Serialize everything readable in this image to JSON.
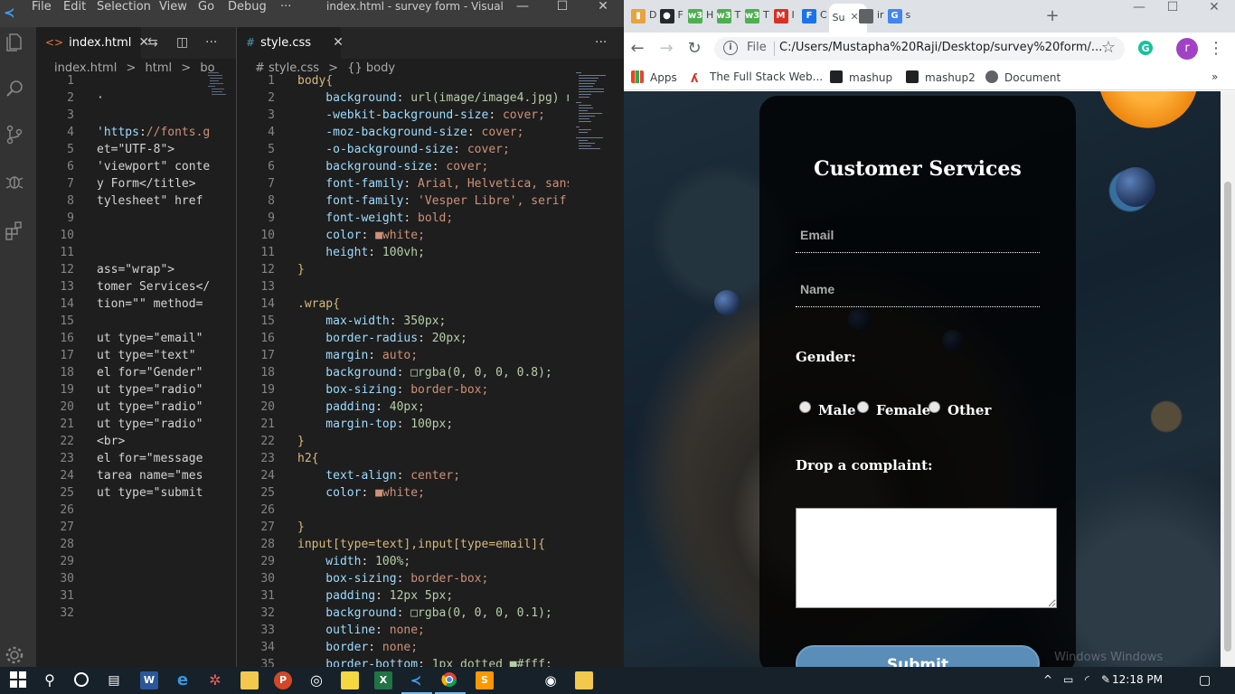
{
  "vscode": {
    "menu": [
      "File",
      "Edit",
      "Selection",
      "View",
      "Go",
      "Debug",
      "···"
    ],
    "window_title": "index.html - survey form - Visual S...",
    "group1": {
      "tab_label": "index.html",
      "breadcrumb": [
        "index.html",
        ">",
        "html",
        ">",
        "bo"
      ],
      "line_numbers": [
        "1",
        "2",
        "3",
        "4",
        "5",
        "6",
        "7",
        "8",
        "9",
        "10",
        "11",
        "12",
        "13",
        "14",
        "15",
        "16",
        "17",
        "18",
        "19",
        "20",
        "21",
        "22",
        "23",
        "24",
        "25",
        "26",
        "27",
        "28",
        "29",
        "30",
        "31",
        "32"
      ],
      "code": [
        "",
        "·",
        "",
        "'https://fonts.g",
        "et=\"UTF-8\">",
        "'viewport\" conte",
        "y Form</title>",
        "tylesheet\" href",
        "",
        "",
        "",
        "ass=\"wrap\">",
        "tomer Services</",
        "tion=\"\" method=",
        "",
        "ut type=\"email\"",
        "ut type=\"text\" ",
        "el for=\"Gender\"",
        "ut type=\"radio\"",
        "ut type=\"radio\"",
        "ut type=\"radio\"",
        "<br>",
        "el for=\"message",
        "tarea name=\"mes",
        "ut type=\"submit",
        "",
        "",
        "",
        "",
        "",
        "",
        ""
      ]
    },
    "group2": {
      "tab_label": "style.css",
      "breadcrumb": [
        "# style.css",
        ">",
        "{} body"
      ],
      "line_numbers": [
        "1",
        "2",
        "3",
        "4",
        "5",
        "6",
        "7",
        "8",
        "9",
        "10",
        "11",
        "12",
        "13",
        "14",
        "15",
        "16",
        "17",
        "18",
        "19",
        "20",
        "21",
        "22",
        "23",
        "24",
        "25",
        "26",
        "27",
        "28",
        "29",
        "30",
        "31",
        "32",
        "33",
        "34",
        "35"
      ],
      "code": [
        "body{",
        "    background: url(image/image4.jpg) n",
        "    -webkit-background-size: cover;",
        "    -moz-background-size: cover;",
        "    -o-background-size: cover;",
        "    background-size: cover;",
        "    font-family: Arial, Helvetica, sans",
        "    font-family: 'Vesper Libre', serif;",
        "    font-weight: bold;",
        "    color: ■white;",
        "    height: 100vh;",
        "}",
        "",
        ".wrap{",
        "    max-width: 350px;",
        "    border-radius: 20px;",
        "    margin: auto;",
        "    background: □rgba(0, 0, 0, 0.8);",
        "    box-sizing: border-box;",
        "    padding: 40px;",
        "    margin-top: 100px;",
        "}",
        "h2{",
        "    text-align: center;",
        "    color: ■white;",
        "",
        "}",
        "input[type=text],input[type=email]{",
        "    width: 100%;",
        "    box-sizing: border-box;",
        "    padding: 12px 5px;",
        "    background: □rgba(0, 0, 0, 0.1);",
        "    outline: none;",
        "    border: none;",
        "    border-bottom: 1px dotted ■#fff;"
      ]
    }
  },
  "chrome": {
    "tabs": [
      {
        "fav": "chart",
        "text": "D",
        "color": "#e8a33d"
      },
      {
        "fav": "github",
        "text": "F",
        "color": "#24292e"
      },
      {
        "fav": "w3",
        "text": "H",
        "color": "#4caf50"
      },
      {
        "fav": "w3",
        "text": "T",
        "color": "#4caf50"
      },
      {
        "fav": "w3",
        "text": "T",
        "color": "#4caf50"
      },
      {
        "fav": "gmail",
        "text": "I",
        "color": "#d93025"
      },
      {
        "fav": "F",
        "text": "C",
        "color": "#1a73e8"
      },
      {
        "fav": "active",
        "text": "Su",
        "color": "#ffffff"
      },
      {
        "fav": "globe",
        "text": "ir",
        "color": "#5f6368"
      },
      {
        "fav": "google",
        "text": "s",
        "color": "#4285f4"
      }
    ],
    "new_tab": "+",
    "window_controls": [
      "—",
      "☐",
      "✕"
    ],
    "nav": {
      "back": "←",
      "forward": "→",
      "reload": "↻"
    },
    "omnibox": {
      "protocol": "File",
      "url": "C:/Users/Mustapha%20Raji/Desktop/survey%20form/..."
    },
    "bookmarks": [
      "Apps",
      "The Full Stack Web...",
      "mashup",
      "mashup2",
      "Document"
    ],
    "profile_initial": "r"
  },
  "page": {
    "heading": "Customer Services",
    "email_placeholder": "Email",
    "name_placeholder": "Name",
    "gender_label": "Gender:",
    "radio_options": [
      "Male",
      "Female",
      "Other"
    ],
    "complaint_label": "Drop a complaint:",
    "submit_label": "Submit",
    "watermark": "Windows   Windows"
  },
  "taskbar": {
    "clock": "12:18 PM",
    "apps": [
      "start",
      "search",
      "cortana",
      "task-view",
      "word",
      "edge",
      "settings",
      "explorer",
      "presenter",
      "chrome-alt",
      "sticky-notes",
      "excel",
      "vscode",
      "chrome",
      "sublime",
      "camera",
      "tool"
    ]
  }
}
